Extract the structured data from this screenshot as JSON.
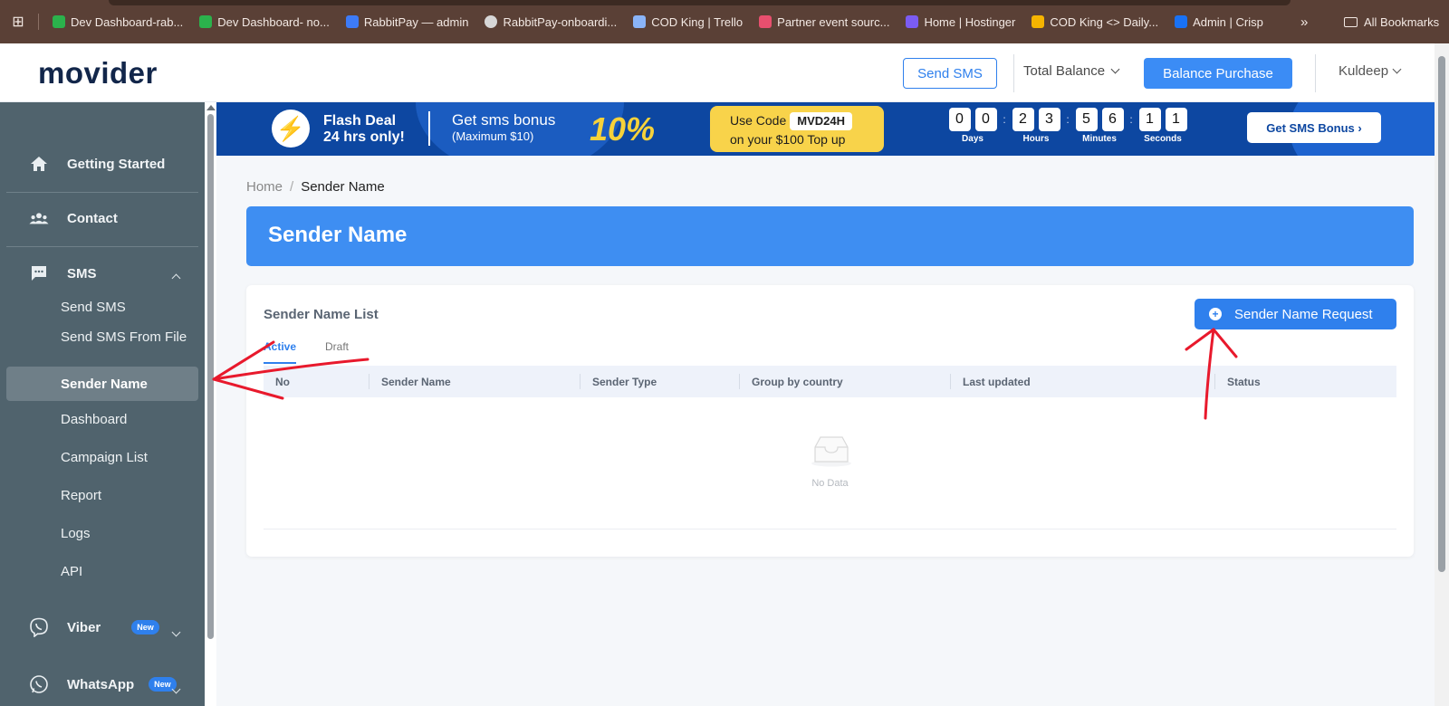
{
  "bookmarks": {
    "items": [
      {
        "label": "Dev Dashboard-rab...",
        "icon": "dollar-icon",
        "color": "#2bb24c"
      },
      {
        "label": "Dev Dashboard- no...",
        "icon": "dollar-icon",
        "color": "#2bb24c"
      },
      {
        "label": "RabbitPay — admin",
        "icon": "arrow-logo-icon",
        "color": "#3d7bf7"
      },
      {
        "label": "RabbitPay-onboardi...",
        "icon": "globe-icon",
        "color": "#d7d7d7"
      },
      {
        "label": "COD King | Trello",
        "icon": "trello-icon",
        "color": "#8ab4f8"
      },
      {
        "label": "Partner event sourc...",
        "icon": "partner-icon",
        "color": "#e84f6e"
      },
      {
        "label": "Home | Hostinger",
        "icon": "hostinger-icon",
        "color": "#7b5cf2"
      },
      {
        "label": "COD King <> Daily...",
        "icon": "video-icon",
        "color": "#f5b400"
      },
      {
        "label": "Admin | Crisp",
        "icon": "chat-icon",
        "color": "#1972f5"
      }
    ],
    "more": "»",
    "all_bookmarks": "All Bookmarks"
  },
  "header": {
    "logo": "movider",
    "send_sms": "Send SMS",
    "total_balance": "Total Balance",
    "balance_purchase": "Balance Purchase",
    "user": "Kuldeep"
  },
  "sidebar": {
    "getting_started": "Getting Started",
    "contact": "Contact",
    "sms": "SMS",
    "sms_items": [
      "Send SMS",
      "Send SMS From File",
      "Sender Name",
      "Dashboard",
      "Campaign List",
      "Report",
      "Logs",
      "API"
    ],
    "active_item": "Sender Name",
    "viber": "Viber",
    "whatsapp": "WhatsApp",
    "new_badge": "New"
  },
  "banner": {
    "flash_line1": "Flash Deal",
    "flash_line2": "24 hrs only!",
    "bonus_title": "Get sms bonus",
    "bonus_sub": "(Maximum $10)",
    "percent": "10%",
    "use_code": "Use Code",
    "code": "MVD24H",
    "topup": "on your $100 Top up",
    "countdown": [
      {
        "digits": [
          "0",
          "0"
        ],
        "label": "Days"
      },
      {
        "digits": [
          "2",
          "3"
        ],
        "label": "Hours"
      },
      {
        "digits": [
          "5",
          "6"
        ],
        "label": "Minutes"
      },
      {
        "digits": [
          "1",
          "1"
        ],
        "label": "Seconds"
      }
    ],
    "cta": "Get SMS Bonus ›"
  },
  "main": {
    "breadcrumb": {
      "home": "Home",
      "separator": "/",
      "current": "Sender Name"
    },
    "page_title": "Sender Name",
    "list_title": "Sender Name List",
    "request_button": "Sender Name Request",
    "tabs": [
      "Active",
      "Draft"
    ],
    "active_tab": "Active",
    "columns": [
      "No",
      "Sender Name",
      "Sender Type",
      "Group by country",
      "Last updated",
      "Status"
    ],
    "empty_text": "No Data"
  },
  "colors": {
    "accent": "#2f80ed",
    "sidebar_bg": "#50636d",
    "banner_bg": "#0d47a1",
    "annotation_arrows": "#e8192c"
  }
}
